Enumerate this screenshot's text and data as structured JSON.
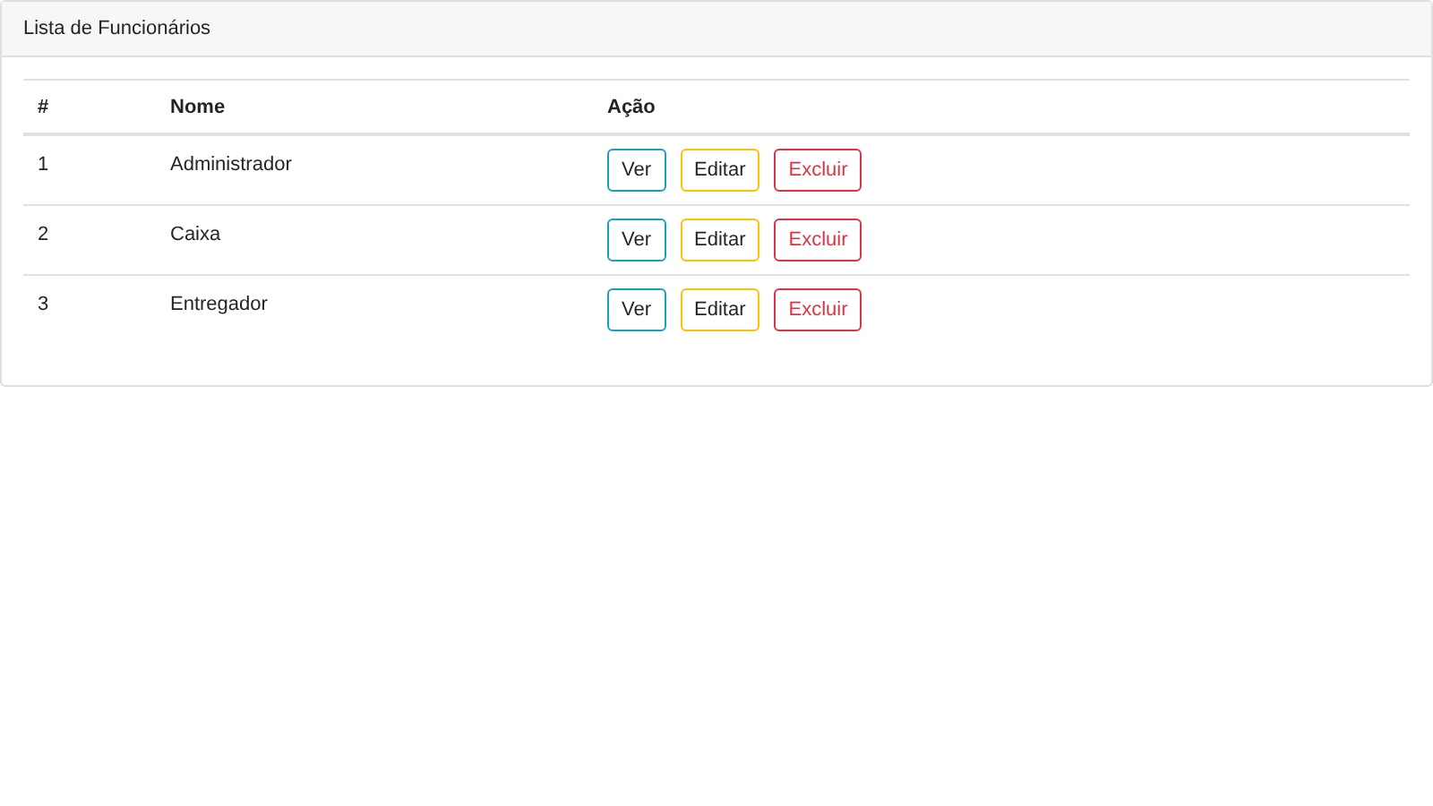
{
  "card": {
    "title": "Lista de Funcionários"
  },
  "table": {
    "columns": [
      "#",
      "Nome",
      "Ação"
    ],
    "rows": [
      {
        "id": "1",
        "name": "Administrador",
        "actions": [
          {
            "label": "Ver",
            "kind": "view"
          },
          {
            "label": "Editar",
            "kind": "edit"
          },
          {
            "label": "Excluir",
            "kind": "delete"
          }
        ]
      },
      {
        "id": "2",
        "name": "Caixa",
        "actions": [
          {
            "label": "Ver",
            "kind": "view"
          },
          {
            "label": "Editar",
            "kind": "edit"
          },
          {
            "label": "Excluir",
            "kind": "delete"
          }
        ]
      },
      {
        "id": "3",
        "name": "Entregador",
        "actions": [
          {
            "label": "Ver",
            "kind": "view"
          },
          {
            "label": "Editar",
            "kind": "edit"
          },
          {
            "label": "Excluir",
            "kind": "delete"
          }
        ]
      }
    ]
  }
}
